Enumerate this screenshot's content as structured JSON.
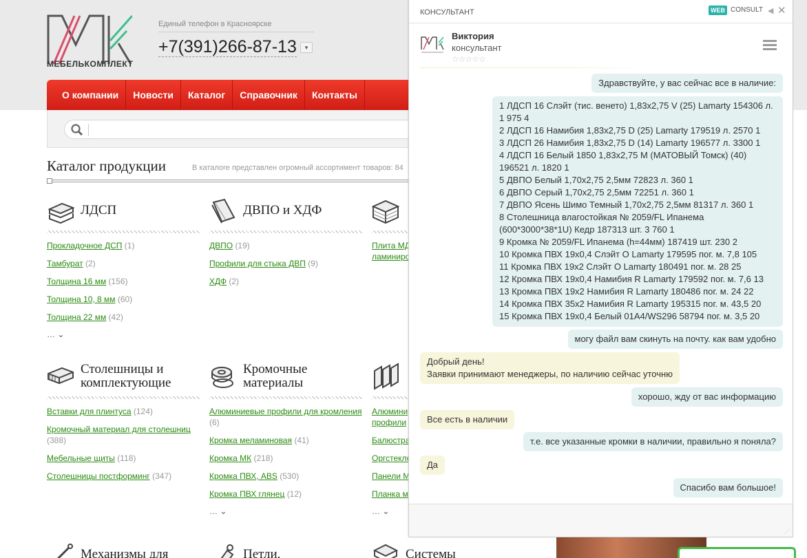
{
  "header": {
    "brand": "МЕБЕЛЬКОМПЛЕКТ",
    "phone_label": "Единый телефон в Красноярске",
    "phone": "+7(391)266-87-13"
  },
  "nav": [
    "О компании",
    "Новости",
    "Каталог",
    "Справочник",
    "Контакты"
  ],
  "catalog": {
    "title": "Каталог продукции",
    "note": "В каталоге представлен огромный ассортимент товаров: 84",
    "more": "…",
    "columns": [
      {
        "title": "ЛДСП",
        "icon": "ldsp-stack-icon",
        "links": [
          {
            "text": "Прокладочное ДСП",
            "count": "(1)"
          },
          {
            "text": "Тамбурат",
            "count": "(2)"
          },
          {
            "text": "Толщина 16 мм",
            "count": "(156)"
          },
          {
            "text": "Толщина 10, 8 мм",
            "count": "(60)"
          },
          {
            "text": "Толщина 22 мм",
            "count": "(42)"
          }
        ]
      },
      {
        "title": "ДВПО и ХДФ",
        "icon": "dvpo-sheets-icon",
        "links": [
          {
            "text": "ДВПО",
            "count": "(19)"
          },
          {
            "text": "Профили для стыка ДВП",
            "count": "(9)"
          },
          {
            "text": "ХДФ",
            "count": "(2)"
          }
        ]
      },
      {
        "title": "",
        "icon": "boards-icon",
        "links": [
          {
            "text": "Плита МД",
            "count": ""
          },
          {
            "text": "ламиниро",
            "count": ""
          }
        ]
      },
      {
        "title": "Столешницы и комплектующие",
        "icon": "countertop-icon",
        "links": [
          {
            "text": "Вставки для плинтуса",
            "count": "(124)"
          },
          {
            "text": "Кромочный материал для столешниц",
            "count": "(388)"
          },
          {
            "text": "Мебельные щиты",
            "count": "(118)"
          },
          {
            "text": "Столешницы постформинг",
            "count": "(347)"
          }
        ]
      },
      {
        "title": "Кромочные материалы",
        "icon": "edge-roll-icon",
        "links": [
          {
            "text": "Алюминиевые профили для кромления",
            "count": "(6)"
          },
          {
            "text": "Кромка меламиновая",
            "count": "(41)"
          },
          {
            "text": "Кромка МК",
            "count": "(218)"
          },
          {
            "text": "Кромка ПВХ, ABS",
            "count": "(530)"
          },
          {
            "text": "Кромка ПВХ глянец",
            "count": "(12)"
          }
        ]
      },
      {
        "title": "",
        "icon": "profiles-icon",
        "links": [
          {
            "text": "Алюмини",
            "count": ""
          },
          {
            "text": "профили",
            "count": ""
          },
          {
            "text": "Балюстра",
            "count": ""
          },
          {
            "text": "Оргстекло",
            "count": ""
          },
          {
            "text": "Панели М",
            "count": ""
          },
          {
            "text": "Планка м",
            "count": ""
          }
        ]
      },
      {
        "title": "Механизмы для",
        "icon": "mechanism-icon",
        "links": []
      },
      {
        "title": "Петли,",
        "icon": "hinge-icon",
        "links": []
      },
      {
        "title": "Системы",
        "icon": "systems-icon",
        "links": []
      }
    ]
  },
  "chat": {
    "panel_title": "КОНСУЛЬТАНТ",
    "brand_badge": "WEB",
    "brand_text": "CONSULT",
    "operator_name": "Виктория",
    "operator_role": "консультант",
    "rating": "☆☆☆☆☆",
    "messages": [
      {
        "from": "visitor",
        "text": "Здравствуйте, у вас сейчас все в наличие:"
      },
      {
        "from": "visitor",
        "lines": [
          "1 ЛДСП 16 Слэйт (тис. венето) 1,83х2,75 V (25) Lamarty 154306 л.",
          "1 975 4",
          "2 ЛДСП 16 Намибия 1,83х2,75 D (25) Lamarty 179519 л. 2570 1",
          "3 ЛДСП 26 Намибия 1,83х2,75 D (14) Lamarty 196577 л. 3300 1",
          "4 ЛДСП 16 Белый 1850 1,83х2,75 М (МАТОВЫЙ Томск) (40)",
          "196521 л. 1820 1",
          "5 ДВПО Белый 1,70х2,75 2,5мм 72823 л. 360 1",
          "6 ДВПО Серый 1,70х2,75 2,5мм 72251 л. 360 1",
          "7 ДВПО Ясень Шимо Темный 1,70х2,75 2,5мм 81317 л. 360 1",
          "8 Столешница влагостойкая № 2059/FL Ипанема",
          "(600*3000*38*1U) Кедр 187313 шт. 3 760 1",
          "9 Кромка № 2059/FL Ипанема (h=44мм) 187419 шт. 230 2",
          "10 Кромка ПВХ 19х0,4 Слэйт О Lamarty 179595 пог. м. 7,8 105",
          "11 Кромка ПВХ 19х2 Слэйт О Lamarty 180491 пог. м. 28 25",
          "12 Кромка ПВХ 19х0,4 Намибия R Lamarty 179592 пог. м. 7,6 13",
          "13 Кромка ПВХ 19х2 Намибия R Lamarty 180486 пог. м. 24 22",
          "14 Кромка ПВХ 35х2 Намибия R Lamarty 195315 пог. м. 43,5 20",
          "15 Кромка ПВХ 19х0,4 Белый 01А4/WS296 58794 пог. м. 3,5 20"
        ]
      },
      {
        "from": "visitor",
        "text": "могу файл вам скинуть на почту. как вам удобно"
      },
      {
        "from": "operator",
        "lines": [
          "Добрый день!",
          "Заявки принимают менеджеры, по наличию сейчас уточню"
        ]
      },
      {
        "from": "visitor",
        "text": "хорошо, жду от вас информацию"
      },
      {
        "from": "operator",
        "text": "Все есть в наличии"
      },
      {
        "from": "visitor",
        "text": "т.е. все указанные кромки в наличии, правильно я поняла?"
      },
      {
        "from": "operator",
        "text": "Да"
      },
      {
        "from": "visitor",
        "text": "Спасибо вам большое!"
      }
    ]
  }
}
